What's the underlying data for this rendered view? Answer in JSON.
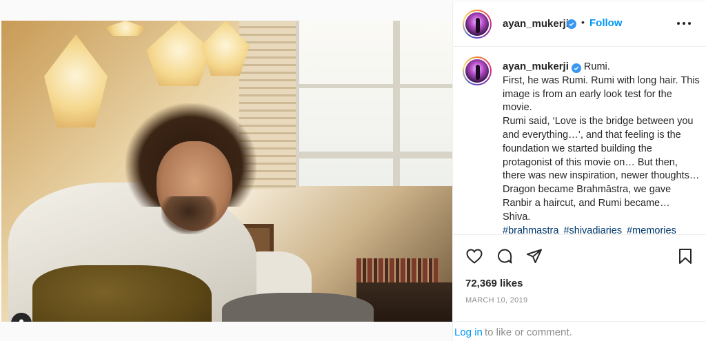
{
  "post": {
    "author": {
      "username": "ayan_mukerji",
      "verified": true
    },
    "header": {
      "separator": "•",
      "follow_label": "Follow",
      "more_icon": "more-horizontal-icon"
    },
    "caption": {
      "username": "ayan_mukerji",
      "title": "Rumi.",
      "lines": [
        "First, he was Rumi. Rumi with long hair. This image is from an early look test for the movie.",
        "Rumi said, ‘Love is the bridge between you and everything…’, and that feeling is the foundation we started building the protagonist of this movie on… But then, there was new inspiration, newer thoughts… Dragon became Brahmāstra, we gave Ranbir a haircut, and Rumi became… Shiva."
      ],
      "hashtags": [
        "#brahmastra",
        "#shivadiaries",
        "#memories"
      ]
    },
    "actions": {
      "like_icon": "heart-icon",
      "comment_icon": "comment-icon",
      "share_icon": "send-icon",
      "save_icon": "bookmark-icon"
    },
    "likes_label": "72,369 likes",
    "date": "MARCH 10, 2019",
    "comment_prompt": {
      "login_link": "Log in",
      "rest": "to like or comment."
    },
    "media": {
      "tag_icon": "user-tag-icon"
    }
  },
  "colors": {
    "link_blue": "#0095f6",
    "hashtag_blue": "#00376b",
    "verified_blue": "#3897f0",
    "muted_gray": "#8e8e8e",
    "text": "#262626"
  }
}
